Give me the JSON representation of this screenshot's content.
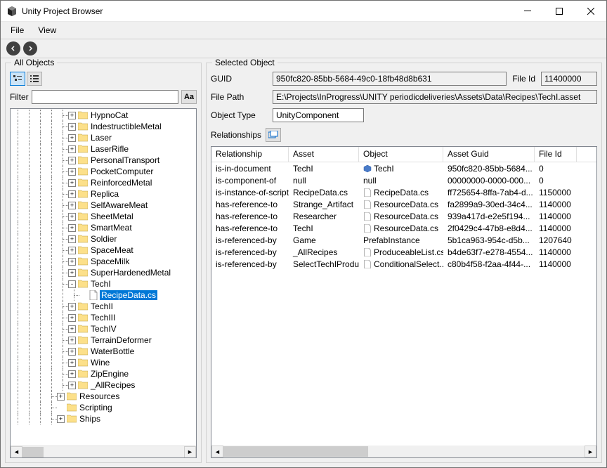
{
  "window": {
    "title": "Unity Project Browser"
  },
  "menu": {
    "file": "File",
    "view": "View"
  },
  "left": {
    "title": "All Objects",
    "filter_label": "Filter",
    "filter_value": "",
    "aa": "Aa",
    "tree": [
      {
        "d": 5,
        "exp": "+",
        "t": "folder",
        "label": "HypnoCat"
      },
      {
        "d": 5,
        "exp": "+",
        "t": "folder",
        "label": "IndestructibleMetal"
      },
      {
        "d": 5,
        "exp": "+",
        "t": "folder",
        "label": "Laser"
      },
      {
        "d": 5,
        "exp": "+",
        "t": "folder",
        "label": "LaserRifle"
      },
      {
        "d": 5,
        "exp": "+",
        "t": "folder",
        "label": "PersonalTransport"
      },
      {
        "d": 5,
        "exp": "+",
        "t": "folder",
        "label": "PocketComputer"
      },
      {
        "d": 5,
        "exp": "+",
        "t": "folder",
        "label": "ReinforcedMetal"
      },
      {
        "d": 5,
        "exp": "+",
        "t": "folder",
        "label": "Replica"
      },
      {
        "d": 5,
        "exp": "+",
        "t": "folder",
        "label": "SelfAwareMeat"
      },
      {
        "d": 5,
        "exp": "+",
        "t": "folder",
        "label": "SheetMetal"
      },
      {
        "d": 5,
        "exp": "+",
        "t": "folder",
        "label": "SmartMeat"
      },
      {
        "d": 5,
        "exp": "+",
        "t": "folder",
        "label": "Soldier"
      },
      {
        "d": 5,
        "exp": "+",
        "t": "folder",
        "label": "SpaceMeat"
      },
      {
        "d": 5,
        "exp": "+",
        "t": "folder",
        "label": "SpaceMilk"
      },
      {
        "d": 5,
        "exp": "+",
        "t": "folder",
        "label": "SuperHardenedMetal"
      },
      {
        "d": 5,
        "exp": "-",
        "t": "folder",
        "label": "TechI"
      },
      {
        "d": 6,
        "exp": "",
        "t": "file",
        "label": "RecipeData.cs",
        "sel": true
      },
      {
        "d": 5,
        "exp": "+",
        "t": "folder",
        "label": "TechII"
      },
      {
        "d": 5,
        "exp": "+",
        "t": "folder",
        "label": "TechIII"
      },
      {
        "d": 5,
        "exp": "+",
        "t": "folder",
        "label": "TechIV"
      },
      {
        "d": 5,
        "exp": "+",
        "t": "folder",
        "label": "TerrainDeformer"
      },
      {
        "d": 5,
        "exp": "+",
        "t": "folder",
        "label": "WaterBottle"
      },
      {
        "d": 5,
        "exp": "+",
        "t": "folder",
        "label": "Wine"
      },
      {
        "d": 5,
        "exp": "+",
        "t": "folder",
        "label": "ZipEngine"
      },
      {
        "d": 5,
        "exp": "+",
        "t": "folder",
        "label": "_AllRecipes"
      },
      {
        "d": 4,
        "exp": "+",
        "t": "folder",
        "label": "Resources"
      },
      {
        "d": 4,
        "exp": "",
        "t": "folder",
        "label": "Scripting"
      },
      {
        "d": 4,
        "exp": "+",
        "t": "folder",
        "label": "Ships"
      }
    ]
  },
  "right": {
    "title": "Selected Object",
    "guid_label": "GUID",
    "guid": "950fc820-85bb-5684-49c0-18fb48d8b631",
    "fileid_label": "File Id",
    "fileid": "11400000",
    "filepath_label": "File Path",
    "filepath": "E:\\Projects\\InProgress\\UNITY periodicdeliveries\\Assets\\Data\\Recipes\\TechI.asset",
    "objtype_label": "Object Type",
    "objtype": "UnityComponent",
    "rel_label": "Relationships",
    "columns": [
      "Relationship",
      "Asset",
      "Object",
      "Asset Guid",
      "File Id"
    ],
    "rows": [
      {
        "rel": "is-in-document",
        "asset": "TechI",
        "obj": "TechI",
        "icon": "cube",
        "guid": "950fc820-85bb-5684...",
        "fid": "0"
      },
      {
        "rel": "is-component-of",
        "asset": "null",
        "obj": "null",
        "icon": "",
        "guid": "00000000-0000-000...",
        "fid": "0"
      },
      {
        "rel": "is-instance-of-script",
        "asset": "RecipeData.cs",
        "obj": "RecipeData.cs",
        "icon": "file",
        "guid": "ff725654-8ffa-7ab4-d...",
        "fid": "1150000"
      },
      {
        "rel": "has-reference-to",
        "asset": "Strange_Artifact",
        "obj": "ResourceData.cs",
        "icon": "file",
        "guid": "fa2899a9-30ed-34c4...",
        "fid": "1140000"
      },
      {
        "rel": "has-reference-to",
        "asset": "Researcher",
        "obj": "ResourceData.cs",
        "icon": "file",
        "guid": "939a417d-e2e5f194...",
        "fid": "1140000"
      },
      {
        "rel": "has-reference-to",
        "asset": "TechI",
        "obj": "ResourceData.cs",
        "icon": "file",
        "guid": "2f0429c4-47b8-e8d4...",
        "fid": "1140000"
      },
      {
        "rel": "is-referenced-by",
        "asset": "Game",
        "obj": "PrefabInstance",
        "icon": "",
        "guid": "5b1ca963-954c-d5b...",
        "fid": "1207640"
      },
      {
        "rel": "is-referenced-by",
        "asset": "_AllRecipes",
        "obj": "ProduceableList.cs",
        "icon": "file",
        "guid": "b4de63f7-e278-4554...",
        "fid": "1140000"
      },
      {
        "rel": "is-referenced-by",
        "asset": "SelectTechIProducer",
        "obj": "ConditionalSelect...",
        "icon": "file",
        "guid": "c80b4f58-f2aa-4f44-...",
        "fid": "1140000"
      }
    ]
  }
}
